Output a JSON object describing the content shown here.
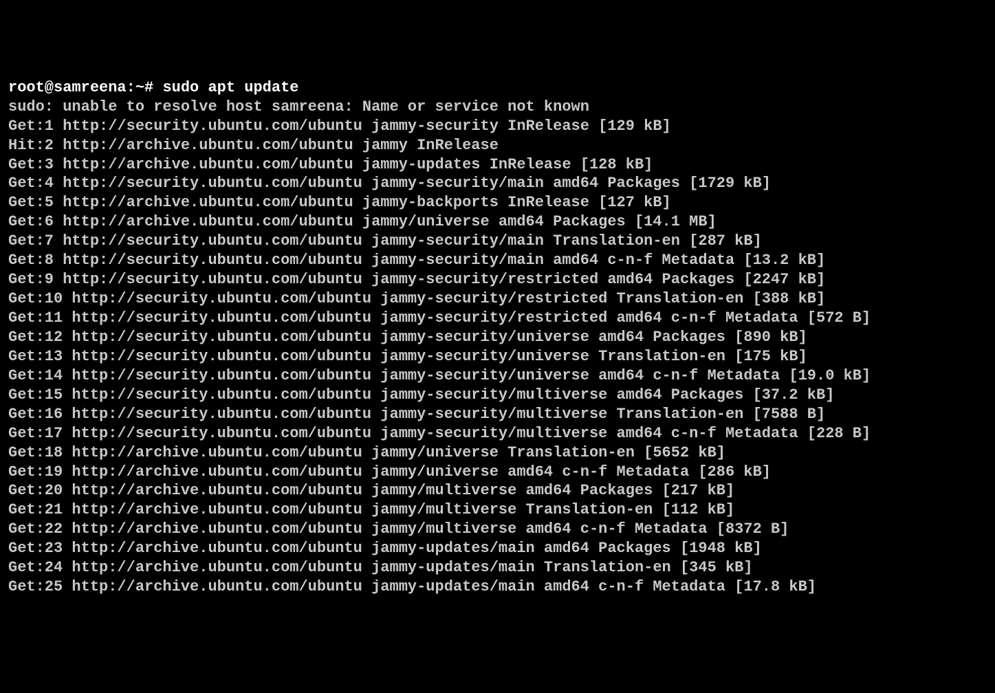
{
  "prompt": "root@samreena:~# ",
  "command": "sudo apt update",
  "lines": [
    "sudo: unable to resolve host samreena: Name or service not known",
    "Get:1 http://security.ubuntu.com/ubuntu jammy-security InRelease [129 kB]",
    "Hit:2 http://archive.ubuntu.com/ubuntu jammy InRelease",
    "Get:3 http://archive.ubuntu.com/ubuntu jammy-updates InRelease [128 kB]",
    "Get:4 http://security.ubuntu.com/ubuntu jammy-security/main amd64 Packages [1729 kB]",
    "Get:5 http://archive.ubuntu.com/ubuntu jammy-backports InRelease [127 kB]",
    "Get:6 http://archive.ubuntu.com/ubuntu jammy/universe amd64 Packages [14.1 MB]",
    "Get:7 http://security.ubuntu.com/ubuntu jammy-security/main Translation-en [287 kB]",
    "Get:8 http://security.ubuntu.com/ubuntu jammy-security/main amd64 c-n-f Metadata [13.2 kB]",
    "Get:9 http://security.ubuntu.com/ubuntu jammy-security/restricted amd64 Packages [2247 kB]",
    "Get:10 http://security.ubuntu.com/ubuntu jammy-security/restricted Translation-en [388 kB]",
    "Get:11 http://security.ubuntu.com/ubuntu jammy-security/restricted amd64 c-n-f Metadata [572 B]",
    "Get:12 http://security.ubuntu.com/ubuntu jammy-security/universe amd64 Packages [890 kB]",
    "Get:13 http://security.ubuntu.com/ubuntu jammy-security/universe Translation-en [175 kB]",
    "Get:14 http://security.ubuntu.com/ubuntu jammy-security/universe amd64 c-n-f Metadata [19.0 kB]",
    "Get:15 http://security.ubuntu.com/ubuntu jammy-security/multiverse amd64 Packages [37.2 kB]",
    "Get:16 http://security.ubuntu.com/ubuntu jammy-security/multiverse Translation-en [7588 B]",
    "Get:17 http://security.ubuntu.com/ubuntu jammy-security/multiverse amd64 c-n-f Metadata [228 B]",
    "Get:18 http://archive.ubuntu.com/ubuntu jammy/universe Translation-en [5652 kB]",
    "Get:19 http://archive.ubuntu.com/ubuntu jammy/universe amd64 c-n-f Metadata [286 kB]",
    "Get:20 http://archive.ubuntu.com/ubuntu jammy/multiverse amd64 Packages [217 kB]",
    "Get:21 http://archive.ubuntu.com/ubuntu jammy/multiverse Translation-en [112 kB]",
    "Get:22 http://archive.ubuntu.com/ubuntu jammy/multiverse amd64 c-n-f Metadata [8372 B]",
    "Get:23 http://archive.ubuntu.com/ubuntu jammy-updates/main amd64 Packages [1948 kB]",
    "Get:24 http://archive.ubuntu.com/ubuntu jammy-updates/main Translation-en [345 kB]",
    "Get:25 http://archive.ubuntu.com/ubuntu jammy-updates/main amd64 c-n-f Metadata [17.8 kB]"
  ]
}
